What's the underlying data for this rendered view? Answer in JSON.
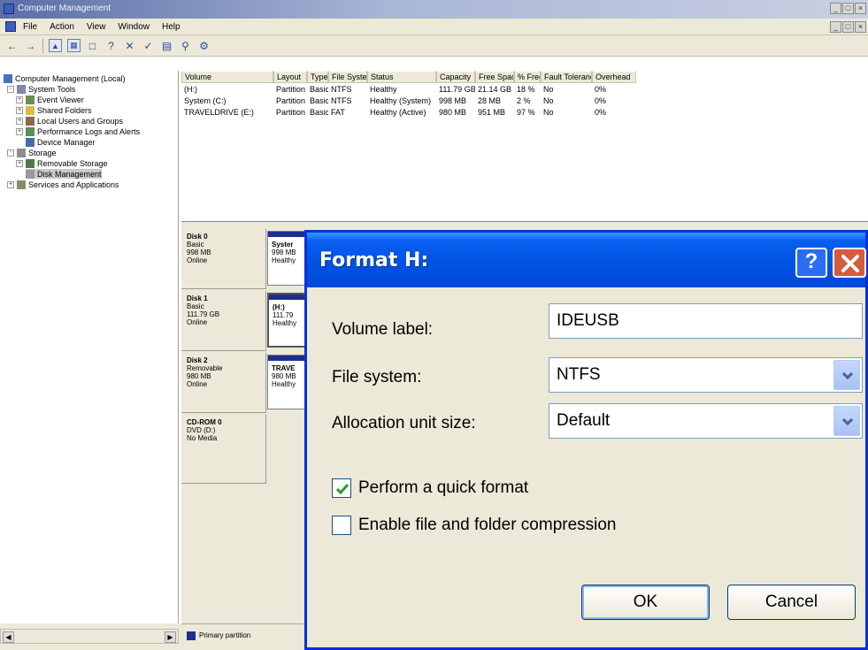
{
  "window": {
    "title": "Computer Management",
    "min": "_",
    "max": "□",
    "close": "×"
  },
  "menu": [
    "File",
    "Action",
    "View",
    "Window",
    "Help"
  ],
  "tree": [
    {
      "label": "Computer Management (Local)",
      "level": 0,
      "expander": ""
    },
    {
      "label": "System Tools",
      "level": 1,
      "expander": "-"
    },
    {
      "label": "Event Viewer",
      "level": 2,
      "expander": "+"
    },
    {
      "label": "Shared Folders",
      "level": 2,
      "expander": "+"
    },
    {
      "label": "Local Users and Groups",
      "level": 2,
      "expander": "+"
    },
    {
      "label": "Performance Logs and Alerts",
      "level": 2,
      "expander": "+"
    },
    {
      "label": "Device Manager",
      "level": 2,
      "expander": ""
    },
    {
      "label": "Storage",
      "level": 1,
      "expander": "-"
    },
    {
      "label": "Removable Storage",
      "level": 2,
      "expander": "+"
    },
    {
      "label": "Disk Management",
      "level": 2,
      "expander": "",
      "selected": true
    },
    {
      "label": "Services and Applications",
      "level": 1,
      "expander": "+"
    }
  ],
  "volume_table": {
    "columns": [
      "Volume",
      "Layout",
      "Type",
      "File System",
      "Status",
      "Capacity",
      "Free Space",
      "% Free",
      "Fault Tolerance",
      "Overhead"
    ],
    "rows": [
      [
        "(H:)",
        "Partition",
        "Basic",
        "NTFS",
        "Healthy",
        "111.79 GB",
        "21.14 GB",
        "18 %",
        "No",
        "0%"
      ],
      [
        "System (C:)",
        "Partition",
        "Basic",
        "NTFS",
        "Healthy (System)",
        "998 MB",
        "28 MB",
        "2 %",
        "No",
        "0%"
      ],
      [
        "TRAVELDRIVE (E:)",
        "Partition",
        "Basic",
        "FAT",
        "Healthy (Active)",
        "980 MB",
        "951 MB",
        "97 %",
        "No",
        "0%"
      ]
    ]
  },
  "disks": [
    {
      "name": "Disk 0",
      "lines": [
        "Basic",
        "998 MB",
        "Online"
      ],
      "part": [
        "Syster",
        "998 MB",
        "Healthy"
      ]
    },
    {
      "name": "Disk 1",
      "lines": [
        "Basic",
        "111.79 GB",
        "Online"
      ],
      "part": [
        "(H:)",
        "111.79",
        "Healthy"
      ]
    },
    {
      "name": "Disk 2",
      "lines": [
        "Removable",
        "980 MB",
        "Online"
      ],
      "part": [
        "TRAVE",
        "980 MB",
        "Healthy"
      ]
    },
    {
      "name": "CD-ROM 0",
      "lines": [
        "DVD (D:)",
        "",
        "No Media"
      ],
      "part": null
    }
  ],
  "legend": {
    "primary": "Primary partition"
  },
  "dialog": {
    "title": "Format H:",
    "help": "?",
    "volume_label_label": "Volume label:",
    "volume_label_value": "IDEUSB",
    "file_system_label": "File system:",
    "file_system_value": "NTFS",
    "alloc_label": "Allocation unit size:",
    "alloc_value": "Default",
    "quick_format_label": "Perform a quick format",
    "quick_format_checked": true,
    "compression_label": "Enable file and folder compression",
    "compression_checked": false,
    "ok_label": "OK",
    "cancel_label": "Cancel"
  }
}
